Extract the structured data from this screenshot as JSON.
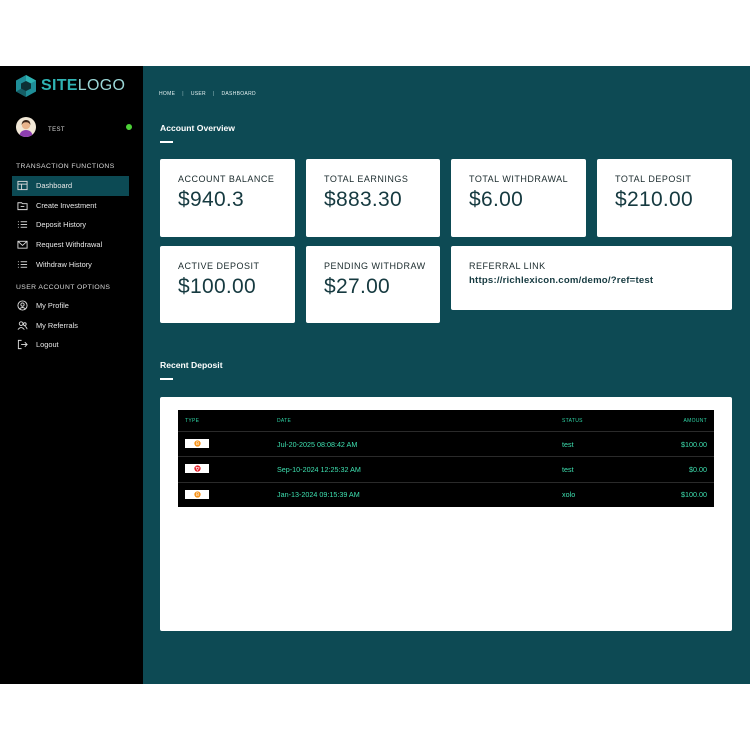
{
  "brand": {
    "logo_text_a": "SITE",
    "logo_text_b": "LOGO"
  },
  "user": {
    "name": "TEST",
    "status_color": "#4cd137"
  },
  "sidebar": {
    "transaction_title": "TRANSACTION FUNCTIONS",
    "transaction_items": [
      {
        "label": "Dashboard",
        "icon": "dashboard-icon",
        "active": true
      },
      {
        "label": "Create Investment",
        "icon": "investment-icon"
      },
      {
        "label": "Deposit History",
        "icon": "list-icon"
      },
      {
        "label": "Request Withdrawal",
        "icon": "mail-icon"
      },
      {
        "label": "Withdraw History",
        "icon": "list-icon"
      }
    ],
    "account_title": "USER ACCOUNT OPTIONS",
    "account_items": [
      {
        "label": "My Profile",
        "icon": "profile-icon"
      },
      {
        "label": "My Referrals",
        "icon": "referrals-icon"
      },
      {
        "label": "Logout",
        "icon": "logout-icon"
      }
    ]
  },
  "breadcrumb": [
    "HOME",
    "USER",
    "DASHBOARD"
  ],
  "overview": {
    "title": "Account Overview",
    "cards": [
      {
        "label": "ACCOUNT BALANCE",
        "value": "$940.3"
      },
      {
        "label": "TOTAL EARNINGS",
        "value": "$883.30"
      },
      {
        "label": "TOTAL WITHDRAWAL",
        "value": "$6.00"
      },
      {
        "label": "TOTAL DEPOSIT",
        "value": "$210.00"
      },
      {
        "label": "ACTIVE DEPOSIT",
        "value": "$100.00"
      },
      {
        "label": "PENDING WITHDRAW",
        "value": "$27.00"
      }
    ],
    "referral": {
      "label": "REFERRAL LINK",
      "url": "https://richlexicon.com/demo/?ref=test"
    }
  },
  "recent_deposit": {
    "title": "Recent Deposit",
    "columns": [
      "TYPE",
      "DATE",
      "STATUS",
      "AMOUNT"
    ],
    "rows": [
      {
        "type_icon": "bitcoin-icon",
        "date": "Jul-20-2025 08:08:42 AM",
        "status": "test",
        "amount": "$100.00"
      },
      {
        "type_icon": "tron-icon",
        "date": "Sep-10-2024 12:25:32 AM",
        "status": "test",
        "amount": "$0.00"
      },
      {
        "type_icon": "bitcoin-icon",
        "date": "Jan-13-2024 09:15:39 AM",
        "status": "xolo",
        "amount": "$100.00"
      }
    ]
  },
  "colors": {
    "main_bg": "#0d4a54",
    "sidebar_bg": "#000000",
    "active_item": "#0c4a54",
    "table_text": "#3ee0b0",
    "bitcoin": "#f7931a",
    "tron": "#e5202a"
  }
}
